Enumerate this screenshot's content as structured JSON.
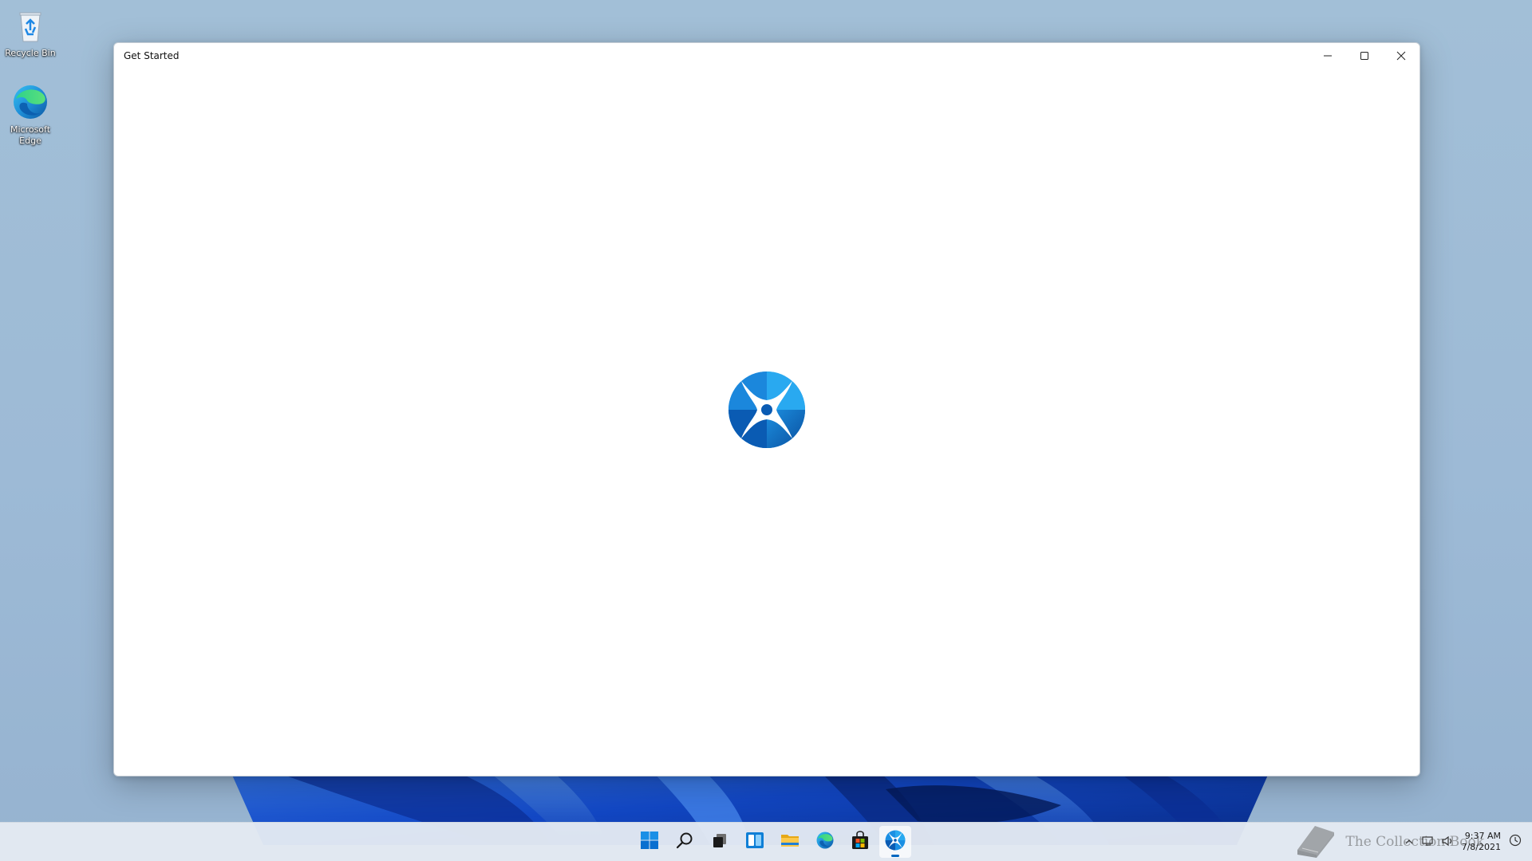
{
  "desktop": {
    "icons": [
      {
        "label": "Recycle Bin",
        "icon": "recycle-bin-icon"
      },
      {
        "label": "Microsoft Edge",
        "icon": "edge-icon"
      }
    ]
  },
  "window": {
    "title": "Get Started",
    "minimize_icon": "minimize-icon",
    "maximize_icon": "maximize-icon",
    "close_icon": "close-icon",
    "splash_icon": "get-started-logo-icon"
  },
  "taskbar": {
    "pinned": [
      {
        "name": "Start",
        "icon": "windows-start-icon",
        "active": false
      },
      {
        "name": "Search",
        "icon": "search-icon",
        "active": false
      },
      {
        "name": "Task View",
        "icon": "task-view-icon",
        "active": false
      },
      {
        "name": "Widgets",
        "icon": "widgets-icon",
        "active": false
      },
      {
        "name": "File Explorer",
        "icon": "file-explorer-icon",
        "active": false
      },
      {
        "name": "Microsoft Edge",
        "icon": "edge-icon",
        "active": false
      },
      {
        "name": "Microsoft Store",
        "icon": "store-icon",
        "active": false
      },
      {
        "name": "Get Started",
        "icon": "get-started-icon",
        "active": true
      }
    ],
    "tray": {
      "time": "9:37 AM",
      "date": "7/8/2021"
    },
    "watermark": "The Collection Book"
  },
  "colors": {
    "accent": "#0067c0",
    "wallpaper": "#9dbad6",
    "bloom_dark": "#0a2e9c",
    "bloom_light": "#2c6ee6"
  }
}
